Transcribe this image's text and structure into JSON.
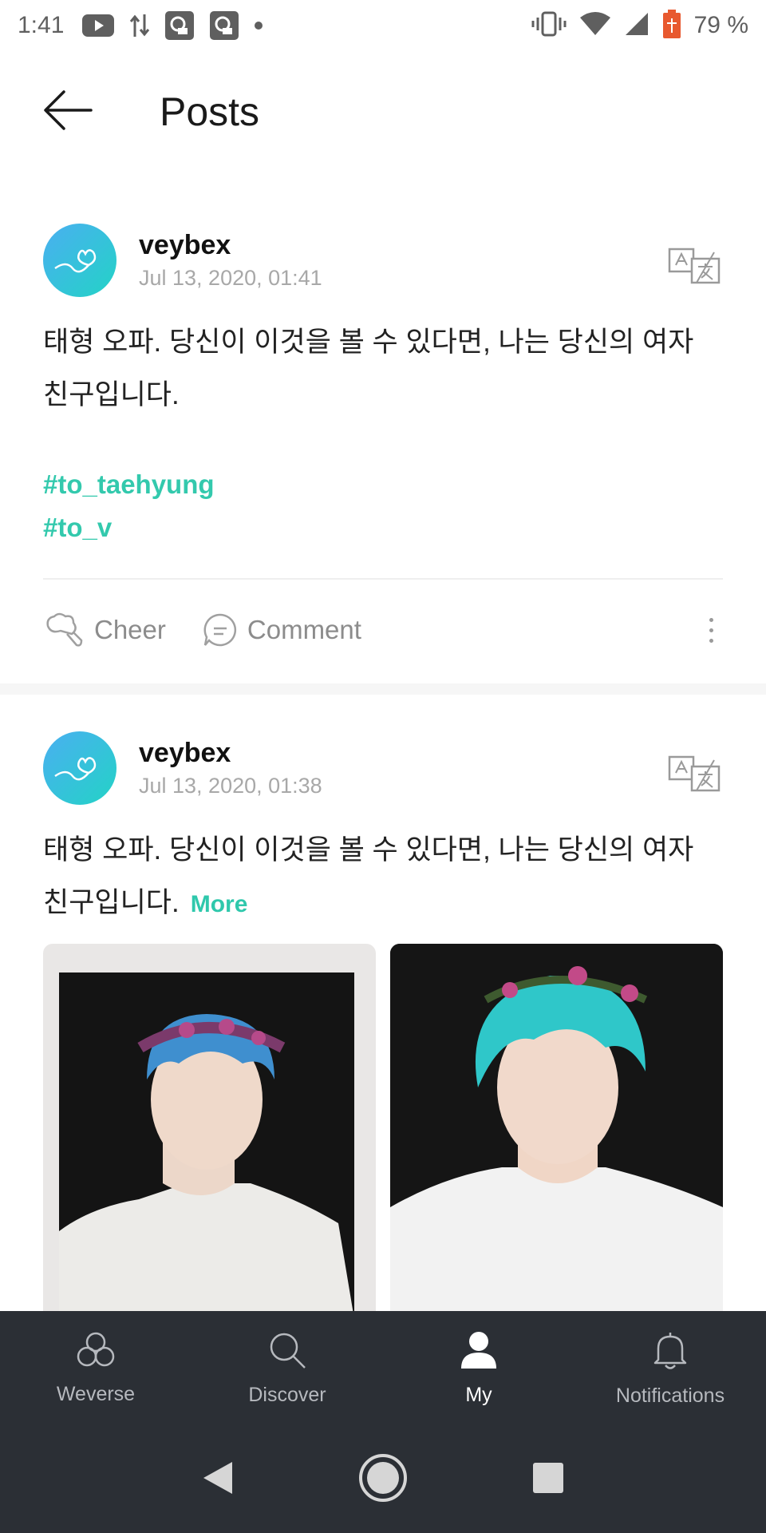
{
  "status_bar": {
    "time": "1:41",
    "battery_percent": "79 %",
    "icons": [
      "youtube-icon",
      "data-transfer-icon",
      "notification-icon",
      "notification-icon",
      "dot-icon",
      "vibrate-icon",
      "wifi-icon",
      "signal-icon",
      "battery-icon"
    ]
  },
  "header": {
    "title": "Posts",
    "back_icon": "arrow-left-icon"
  },
  "posts": [
    {
      "username": "veybex",
      "timestamp": "Jul 13, 2020, 01:41",
      "body": "태형 오파. 당신이 이것을 볼 수 있다면, 나는 당신의 여자 친구입니다.",
      "tags": [
        "#to_taehyung",
        "#to_v"
      ],
      "cheer_label": "Cheer",
      "comment_label": "Comment"
    },
    {
      "username": "veybex",
      "timestamp": "Jul 13, 2020, 01:38",
      "body": "태형 오파. 당신이 이것을 볼 수 있다면, 나는 당신의 여자 친구입니다.",
      "more_label": "More",
      "images": [
        "drawing-photo",
        "reference-photo"
      ]
    }
  ],
  "bottom_nav": {
    "items": [
      {
        "label": "Weverse",
        "icon": "weverse-icon"
      },
      {
        "label": "Discover",
        "icon": "search-icon"
      },
      {
        "label": "My",
        "icon": "person-icon",
        "active": true
      },
      {
        "label": "Notifications",
        "icon": "bell-icon"
      }
    ]
  },
  "colors": {
    "accent": "#33c9ad",
    "nav_bg": "#2b2f35",
    "avatar_start": "#4aaff1",
    "avatar_end": "#23d3c6"
  }
}
